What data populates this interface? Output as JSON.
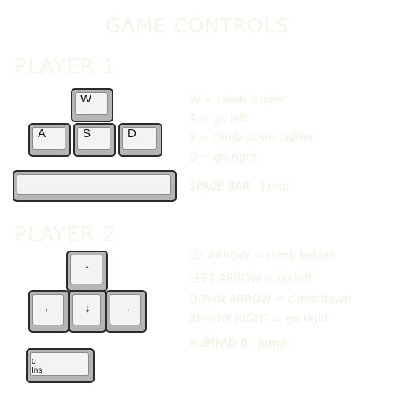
{
  "page_title": "GAME CONTROLS",
  "player1": {
    "heading": "PLAYER 1",
    "keys": {
      "w": "W",
      "a": "A",
      "s": "S",
      "d": "D",
      "space": ""
    },
    "descriptions": [
      "W = climb ladder",
      "A = go left",
      "S = climb down ladder",
      "D = go right",
      "SPACE BAR - jump"
    ]
  },
  "player2": {
    "heading": "PLAYER 2",
    "keys": {
      "up": "↑",
      "left": "←",
      "down": "↓",
      "right": "→",
      "numpad0_number": "0",
      "numpad0_ins": "Ins"
    },
    "descriptions": [
      "UP ARROW = climb ladder",
      "LEFT ARROW = go left",
      "DOWN ARROW = climb down",
      "ARROW RIGHT = go right",
      "NUMPAD 0 - jump"
    ]
  },
  "colors": {
    "text_faint": "#f3f0e2",
    "key_face": "#f3f3f3",
    "key_side": "#b5b5b5",
    "key_border": "#2b2b2b"
  }
}
